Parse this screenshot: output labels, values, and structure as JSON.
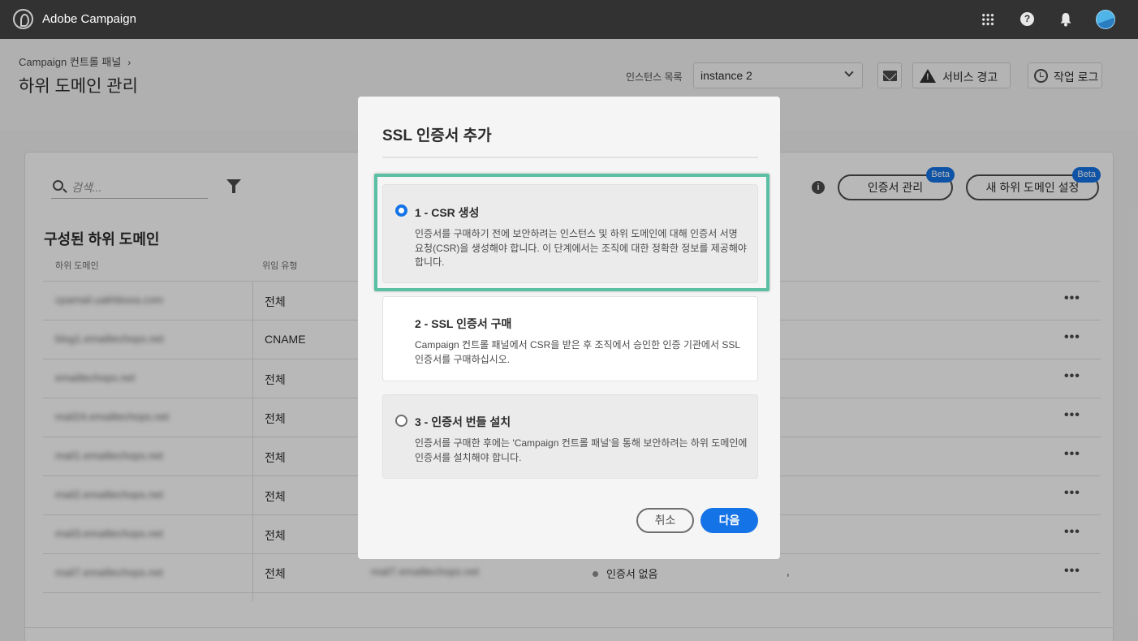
{
  "app": {
    "title": "Adobe Campaign"
  },
  "icons": {
    "brand": "adobe-campaign-logo",
    "apps": "grid-icon",
    "help": "help-icon",
    "notifications": "bell-icon",
    "user": "avatar"
  },
  "header": {
    "breadcrumb": "Campaign 컨트롤 패널",
    "title": "하위 도메인 관리",
    "instance_label": "인스턴스 목록",
    "instance_value": "instance 2",
    "alerts_label": "서비스 경고",
    "log_label": "작업 로그"
  },
  "toolbar": {
    "search_placeholder": "검색...",
    "manage_certs_label": "인증서 관리",
    "new_subdomain_label": "새 하위 도메인 설정",
    "beta_label": "Beta"
  },
  "table": {
    "section_title": "구성된 하위 도메인",
    "columns": [
      "하위 도메인",
      "위임 유형"
    ],
    "rows": [
      {
        "subdomain": "cpamail.uakhboxa.com",
        "type": "전체"
      },
      {
        "subdomain": "blog1.emailtechops.net",
        "type": "CNAME"
      },
      {
        "subdomain": "emailtechops.net",
        "type": "전체"
      },
      {
        "subdomain": "mail24.emailtechops.net",
        "type": "전체"
      },
      {
        "subdomain": "mail1.emailtechops.net",
        "type": "전체"
      },
      {
        "subdomain": "mail2.emailtechops.net",
        "type": "전체"
      },
      {
        "subdomain": "mail3.emailtechops.net",
        "type": "전체"
      },
      {
        "subdomain": "mail7.emailtechops.net",
        "type": "전체",
        "subdomain2": "mail7.emailtechops.net",
        "status": "인증서 없음",
        "extra": ","
      }
    ],
    "more_label": "•••"
  },
  "modal": {
    "title": "SSL 인증서 추가",
    "steps": [
      {
        "title": "1 - CSR 생성",
        "desc": "인증서를 구매하기 전에 보안하려는 인스턴스 및 하위 도메인에 대해 인증서 서명 요청(CSR)을 생성해야 합니다. 이 단계에서는 조직에 대한 정확한 정보를 제공해야 합니다.",
        "selected": true
      },
      {
        "title": "2 - SSL 인증서 구매",
        "desc": "Campaign 컨트롤 패널에서 CSR을 받은 후 조직에서 승인한 인증 기관에서 SSL 인증서를 구매하십시오.",
        "selected": false
      },
      {
        "title": "3 - 인증서 번들 설치",
        "desc": "인증서를 구매한 후에는 'Campaign 컨트롤 패널'을 통해 보안하려는 하위 도메인에 인증서를 설치해야 합니다.",
        "selected": false
      }
    ],
    "cancel_label": "취소",
    "next_label": "다음"
  },
  "colors": {
    "accent": "#1473e6",
    "highlight": "#5bbfa3",
    "topbar": "#323232"
  }
}
